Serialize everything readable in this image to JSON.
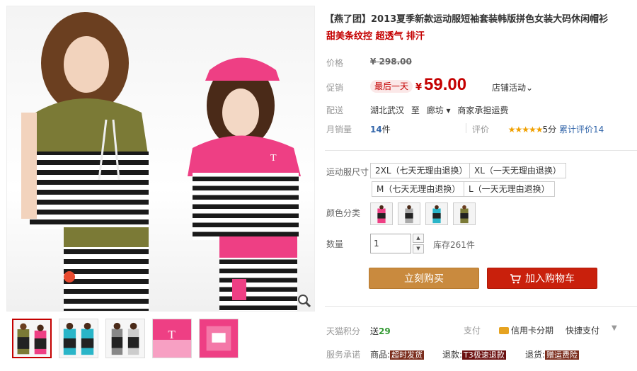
{
  "product": {
    "title": "【燕了团】2013夏季新款运动服短袖套装韩版拼色女装大码休闲帽衫",
    "subtitle": "甜美条纹控 超透气 排汗"
  },
  "price": {
    "label": "价格",
    "original": "¥ 298.00"
  },
  "promo": {
    "label": "促销",
    "tag": "最后一天",
    "currency": "¥",
    "price": "59.00",
    "shop_event": "店铺活动⌄"
  },
  "shipping": {
    "label": "配送",
    "from": "湖北武汉",
    "to_word": "至",
    "dest": "廊坊 ▾",
    "fee": "商家承担运费"
  },
  "sales": {
    "label": "月销量",
    "count": "14",
    "unit": "件",
    "rating_label": "评价",
    "stars": "★★★★★",
    "score": "5分",
    "reviews": "累计评价14"
  },
  "size": {
    "label": "运动服尺寸",
    "options": [
      "2XL（七天无理由退换）",
      "XL（一天无理由退换）",
      "M（七天无理由退换）",
      "L（一天无理由退换）"
    ]
  },
  "color": {
    "label": "颜色分类"
  },
  "quantity": {
    "label": "数量",
    "value": "1",
    "up": "▲",
    "down": "▼",
    "stock": "库存261件"
  },
  "buttons": {
    "buy": "立刻购买",
    "cart": "加入购物车"
  },
  "points": {
    "label": "天猫积分",
    "prefix": "送",
    "value": "29"
  },
  "payment": {
    "label": "支付",
    "card": "信用卡分期",
    "guarantee": "快捷支付",
    "arrow": "▼"
  },
  "service": {
    "label": "服务承诺",
    "goods_label": "商品:",
    "goods_tag": "超时发货",
    "refund_label": "退款:",
    "refund_tag": "T3极速退款",
    "return_label": "退货:",
    "return_tag": "赠运费险"
  },
  "colors": {
    "accent_red": "#c40000",
    "buy_orange": "#c98a3e",
    "cart_red": "#c9200c",
    "olive": "#7b7a36",
    "pink": "#ee3f84",
    "teal": "#2ab5c8"
  }
}
